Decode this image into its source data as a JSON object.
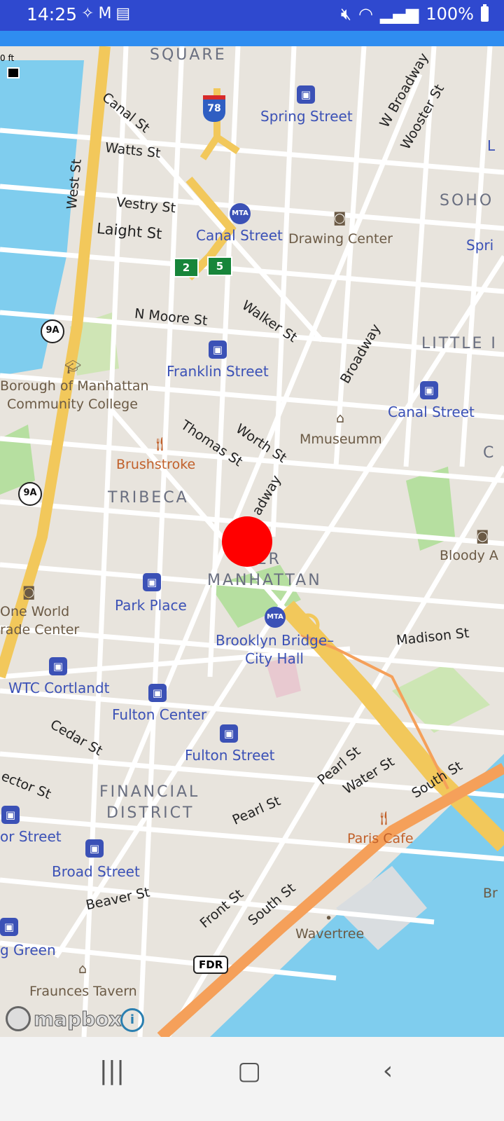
{
  "status_bar": {
    "time": "14:25",
    "left_icons": [
      "tools-icon",
      "gmail-icon",
      "message-icon"
    ],
    "battery": "100%",
    "right_icons": [
      "mute-icon",
      "wifi-icon",
      "signal-icon",
      "battery-icon"
    ]
  },
  "map": {
    "scale_text": "0 ft",
    "districts": [
      "SQUARE",
      "SOHO",
      "LITTLE I",
      "TRIBECA",
      "WER",
      "MANHATTAN",
      "FINANCIAL",
      "DISTRICT"
    ],
    "streets": [
      "Canal St",
      "Watts St",
      "Vestry St",
      "Laight St",
      "West St",
      "N Moore St",
      "Walker St",
      "Broadway",
      "W Broadway",
      "Wooster St",
      "Thomas St",
      "Worth St",
      "adway",
      "Madison St",
      "Cedar St",
      "ector St",
      "Pearl St",
      "Water St",
      "South St",
      "Pearl St",
      "Beaver St",
      "Front St",
      "South St"
    ],
    "stations": [
      "Spring Street",
      "Canal Street",
      "Franklin Street",
      "Canal Street",
      "Park Place",
      "Brooklyn Bridge–",
      "City Hall",
      "WTC Cortlandt",
      "Fulton Center",
      "Fulton Street",
      "or Street",
      "Broad Street",
      "g Green",
      "Spri"
    ],
    "pois": [
      "Drawing Center",
      "Borough of Manhattan",
      "Community College",
      "Mmuseumm",
      "One World",
      "rade Center",
      "Bloody A",
      "Wavertree",
      "Fraunces Tavern",
      "Br"
    ],
    "food": [
      "Brushstroke",
      "Paris Cafe"
    ],
    "route_badges": [
      "9A",
      "9A"
    ],
    "interstate": "78",
    "exit_signs": [
      "2",
      "5"
    ],
    "fdr": "FDR",
    "edge_labels": [
      "L",
      "C"
    ],
    "colors": {
      "water": "#7fcdee",
      "highway": "#f2c85b",
      "expressway": "#f5a05a",
      "park": "#b6dfa0",
      "marker": "#ff0000"
    }
  },
  "attribution": {
    "logo_text": "mapbox",
    "info": "i"
  },
  "nav_bar": {
    "recent": "|||",
    "home": "▢",
    "back": "‹"
  }
}
